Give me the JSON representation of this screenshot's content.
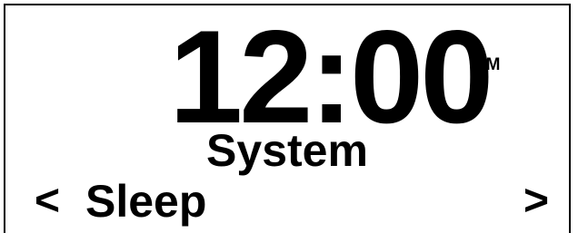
{
  "display": {
    "time": "12:00",
    "band": "FM",
    "menu_title": "System",
    "item": {
      "prev_arrow": "<",
      "label": "Sleep",
      "next_arrow": ">"
    }
  },
  "colors": {
    "background": "#ffffff",
    "foreground": "#000000"
  }
}
